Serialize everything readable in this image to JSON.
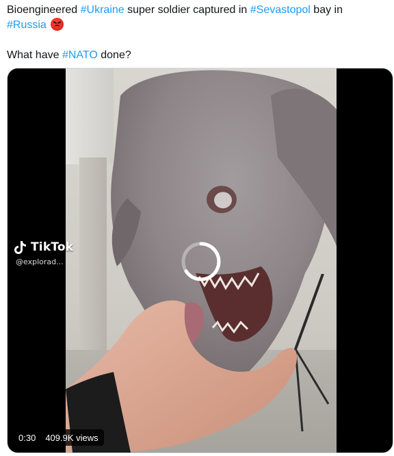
{
  "tweet": {
    "line1": {
      "text_a": "Bioengineered ",
      "tag_ukraine": "#Ukraine",
      "text_b": " super soldier captured in ",
      "tag_sevastopol": "#Sevastopol",
      "text_c": " bay in "
    },
    "line2": {
      "tag_russia": "#Russia"
    },
    "line3": {
      "text_a": "What have ",
      "tag_nato": "#NATO",
      "text_b": " done?"
    },
    "emoji_icon": "angry-face-icon"
  },
  "media": {
    "watermark": {
      "brand": "TikTok",
      "handle": "@explorad..."
    },
    "duration": "0:30",
    "views": "409.9K views",
    "spinner_icon": "loading-spinner-icon"
  },
  "colors": {
    "hashtag": "#1d9bf0",
    "text": "#0f1419",
    "media_bg": "#000000"
  }
}
